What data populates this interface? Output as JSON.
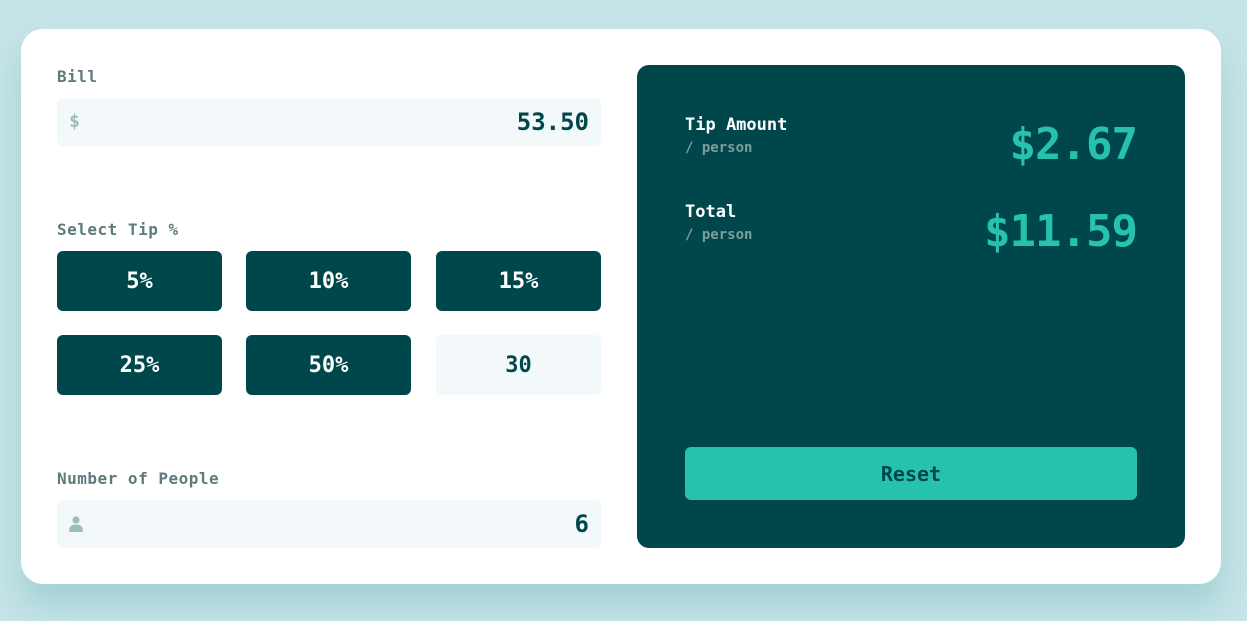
{
  "bill": {
    "label": "Bill",
    "currency_icon": "$",
    "value": "53.50"
  },
  "tip": {
    "label": "Select Tip %",
    "options": [
      "5%",
      "10%",
      "15%",
      "25%",
      "50%"
    ],
    "custom_value": "30"
  },
  "people": {
    "label": "Number of People",
    "icon": "person-icon",
    "value": "6"
  },
  "results": {
    "tip_amount": {
      "title": "Tip Amount",
      "sub": "/ person",
      "value": "$2.67"
    },
    "total": {
      "title": "Total",
      "sub": "/ person",
      "value": "$11.59"
    },
    "reset_label": "Reset"
  },
  "colors": {
    "background": "#c5e4e7",
    "dark_teal": "#00474b",
    "accent": "#26c2ae",
    "input_bg": "#f3f9fa"
  }
}
